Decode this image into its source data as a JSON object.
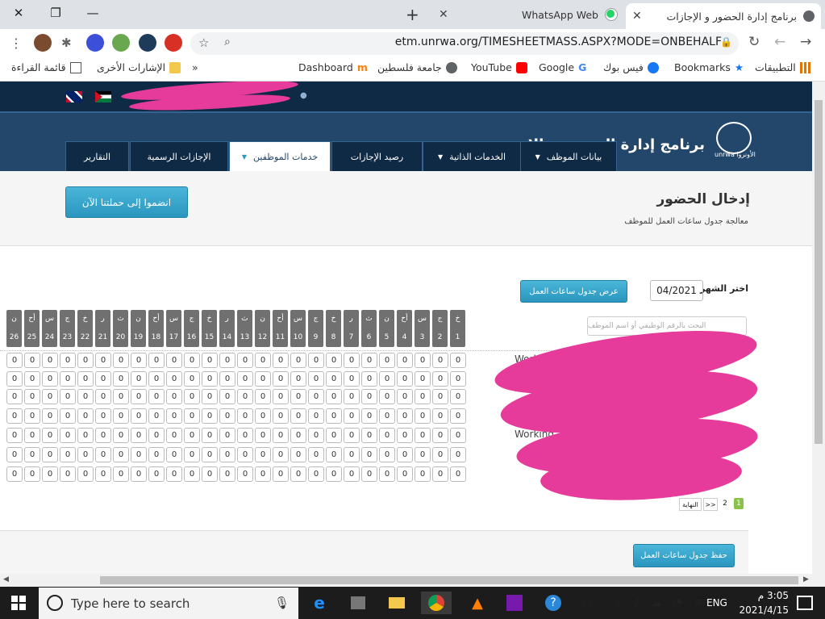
{
  "browser": {
    "tabs": [
      {
        "title": "برنامج إدارة الحضور و الإجازات",
        "active": true
      },
      {
        "title": "WhatsApp Web",
        "active": false
      }
    ],
    "new_tab": "+",
    "url": "etm.unrwa.org/TIMESHEETMASS.ASPX?MODE=ONBEHALF",
    "bookmarks": [
      {
        "label": "التطبيقات"
      },
      {
        "label": "Bookmarks"
      },
      {
        "label": "فيس بوك"
      },
      {
        "label": "Google"
      },
      {
        "label": "YouTube"
      },
      {
        "label": "جامعة فلسطين"
      },
      {
        "label": "Dashboard"
      },
      {
        "label": "»"
      },
      {
        "label": "الإشارات الأخرى"
      },
      {
        "label": "قائمة القراءة"
      }
    ]
  },
  "site": {
    "header_title": "برنامج إدارة الحضور و الإجازات",
    "logo_text": "unrwa الأونروا",
    "nav": [
      {
        "label": "بيانات الموظف",
        "dropdown": true
      },
      {
        "label": "الخدمات الذاتية",
        "dropdown": true
      },
      {
        "label": "رصيد الإجازات",
        "dropdown": false
      },
      {
        "label": "خدمات الموظفين",
        "dropdown": true,
        "active": true
      },
      {
        "label": "الإجازات الرسمية",
        "dropdown": false
      },
      {
        "label": "التقارير",
        "dropdown": false
      }
    ],
    "campaign_button": "انضموا إلى حملتنا الآن",
    "page_title": "إدخال الحضور",
    "page_subtitle": "معالجة جدول ساعات العمل للموظف"
  },
  "form": {
    "month_label": "اختر الشهر",
    "month_value": "04/2021",
    "show_button": "عرض جدول ساعات العمل",
    "search_placeholder": "البحث بالرقم الوظيفي أو اسم الموظف",
    "save_button": "حفظ جدول ساعات العمل"
  },
  "grid": {
    "days": [
      {
        "d": "1",
        "w": "خ"
      },
      {
        "d": "2",
        "w": "ج"
      },
      {
        "d": "3",
        "w": "س"
      },
      {
        "d": "4",
        "w": "أح"
      },
      {
        "d": "5",
        "w": "ن"
      },
      {
        "d": "6",
        "w": "ث"
      },
      {
        "d": "7",
        "w": "ر"
      },
      {
        "d": "8",
        "w": "خ"
      },
      {
        "d": "9",
        "w": "ج"
      },
      {
        "d": "10",
        "w": "س"
      },
      {
        "d": "11",
        "w": "أح"
      },
      {
        "d": "12",
        "w": "ن"
      },
      {
        "d": "13",
        "w": "ث"
      },
      {
        "d": "14",
        "w": "ر"
      },
      {
        "d": "15",
        "w": "خ"
      },
      {
        "d": "16",
        "w": "ج"
      },
      {
        "d": "17",
        "w": "س"
      },
      {
        "d": "18",
        "w": "أح"
      },
      {
        "d": "19",
        "w": "ن"
      },
      {
        "d": "20",
        "w": "ث"
      },
      {
        "d": "21",
        "w": "ر"
      },
      {
        "d": "22",
        "w": "خ"
      },
      {
        "d": "23",
        "w": "ج"
      },
      {
        "d": "24",
        "w": "س"
      },
      {
        "d": "25",
        "w": "أح"
      },
      {
        "d": "26",
        "w": "ن"
      }
    ],
    "rows": [
      {
        "label": "Work",
        "value": "0"
      },
      {
        "label": "",
        "value": "0"
      },
      {
        "label": "",
        "value": "0"
      },
      {
        "label": "Working Hours",
        "value": "0"
      },
      {
        "label": "Working",
        "value": "0"
      },
      {
        "label": "",
        "value": "0"
      },
      {
        "label": "",
        "value": "0"
      }
    ],
    "pager": {
      "current": "1",
      "next": "2",
      "forward": ">>",
      "last": "النهاية"
    }
  },
  "taskbar": {
    "search_placeholder": "Type here to search",
    "lang": "ENG",
    "time": "3:05 م",
    "date": "2021/4/15"
  }
}
